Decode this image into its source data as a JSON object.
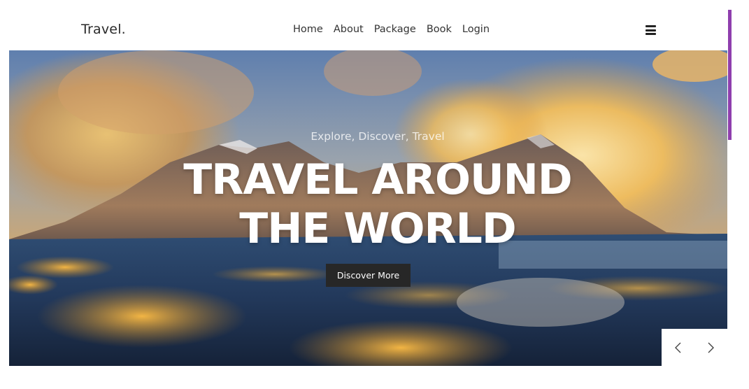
{
  "brand": {
    "logo": "Travel."
  },
  "nav": {
    "items": [
      {
        "label": "Home"
      },
      {
        "label": "About"
      },
      {
        "label": "Package"
      },
      {
        "label": "Book"
      },
      {
        "label": "Login"
      }
    ],
    "menu_icon": "hamburger-menu-icon"
  },
  "hero": {
    "subtitle": "Explore, Discover, Travel",
    "title_line1": "TRAVEL AROUND",
    "title_line2": "THE WORLD",
    "cta_label": "Discover More",
    "background": "mountain-landscape-image"
  },
  "slider": {
    "prev_icon": "chevron-left-icon",
    "next_icon": "chevron-right-icon"
  },
  "colors": {
    "cta_bg": "#272727",
    "scrollbar_accent": "#8f3fae",
    "text_primary": "#333333"
  }
}
